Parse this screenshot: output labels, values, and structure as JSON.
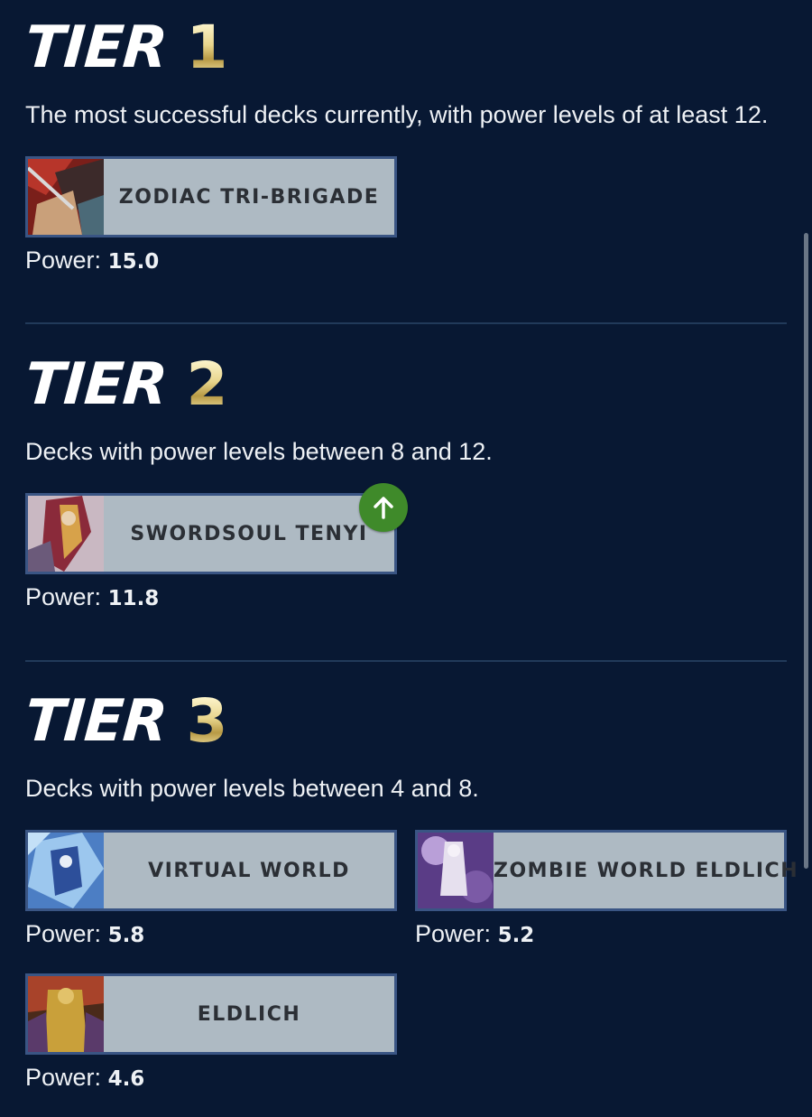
{
  "colors": {
    "background": "#081833",
    "card": "#aebac3",
    "card_border": "#3a5584",
    "badge": "#3f8a2a",
    "tier_gold": "#e8d58c"
  },
  "tiers": [
    {
      "word": "TIER",
      "number": "1",
      "description": "The most successful decks currently, with power levels of at least 12.",
      "decks": [
        {
          "name": "ZODIAC TRI-BRIGADE",
          "power_label": "Power:",
          "power": "15.0",
          "trend": null
        }
      ]
    },
    {
      "word": "TIER",
      "number": "2",
      "description": "Decks with power levels between 8 and 12.",
      "decks": [
        {
          "name": "SWORDSOUL TENYI",
          "power_label": "Power:",
          "power": "11.8",
          "trend": "up-arrow-icon"
        }
      ]
    },
    {
      "word": "TIER",
      "number": "3",
      "description": "Decks with power levels between 4 and 8.",
      "decks": [
        {
          "name": "VIRTUAL WORLD",
          "power_label": "Power:",
          "power": "5.8",
          "trend": null
        },
        {
          "name": "ZOMBIE WORLD ELDLICH",
          "power_label": "Power:",
          "power": "5.2",
          "trend": null
        },
        {
          "name": "ELDLICH",
          "power_label": "Power:",
          "power": "4.6",
          "trend": null
        }
      ]
    }
  ]
}
